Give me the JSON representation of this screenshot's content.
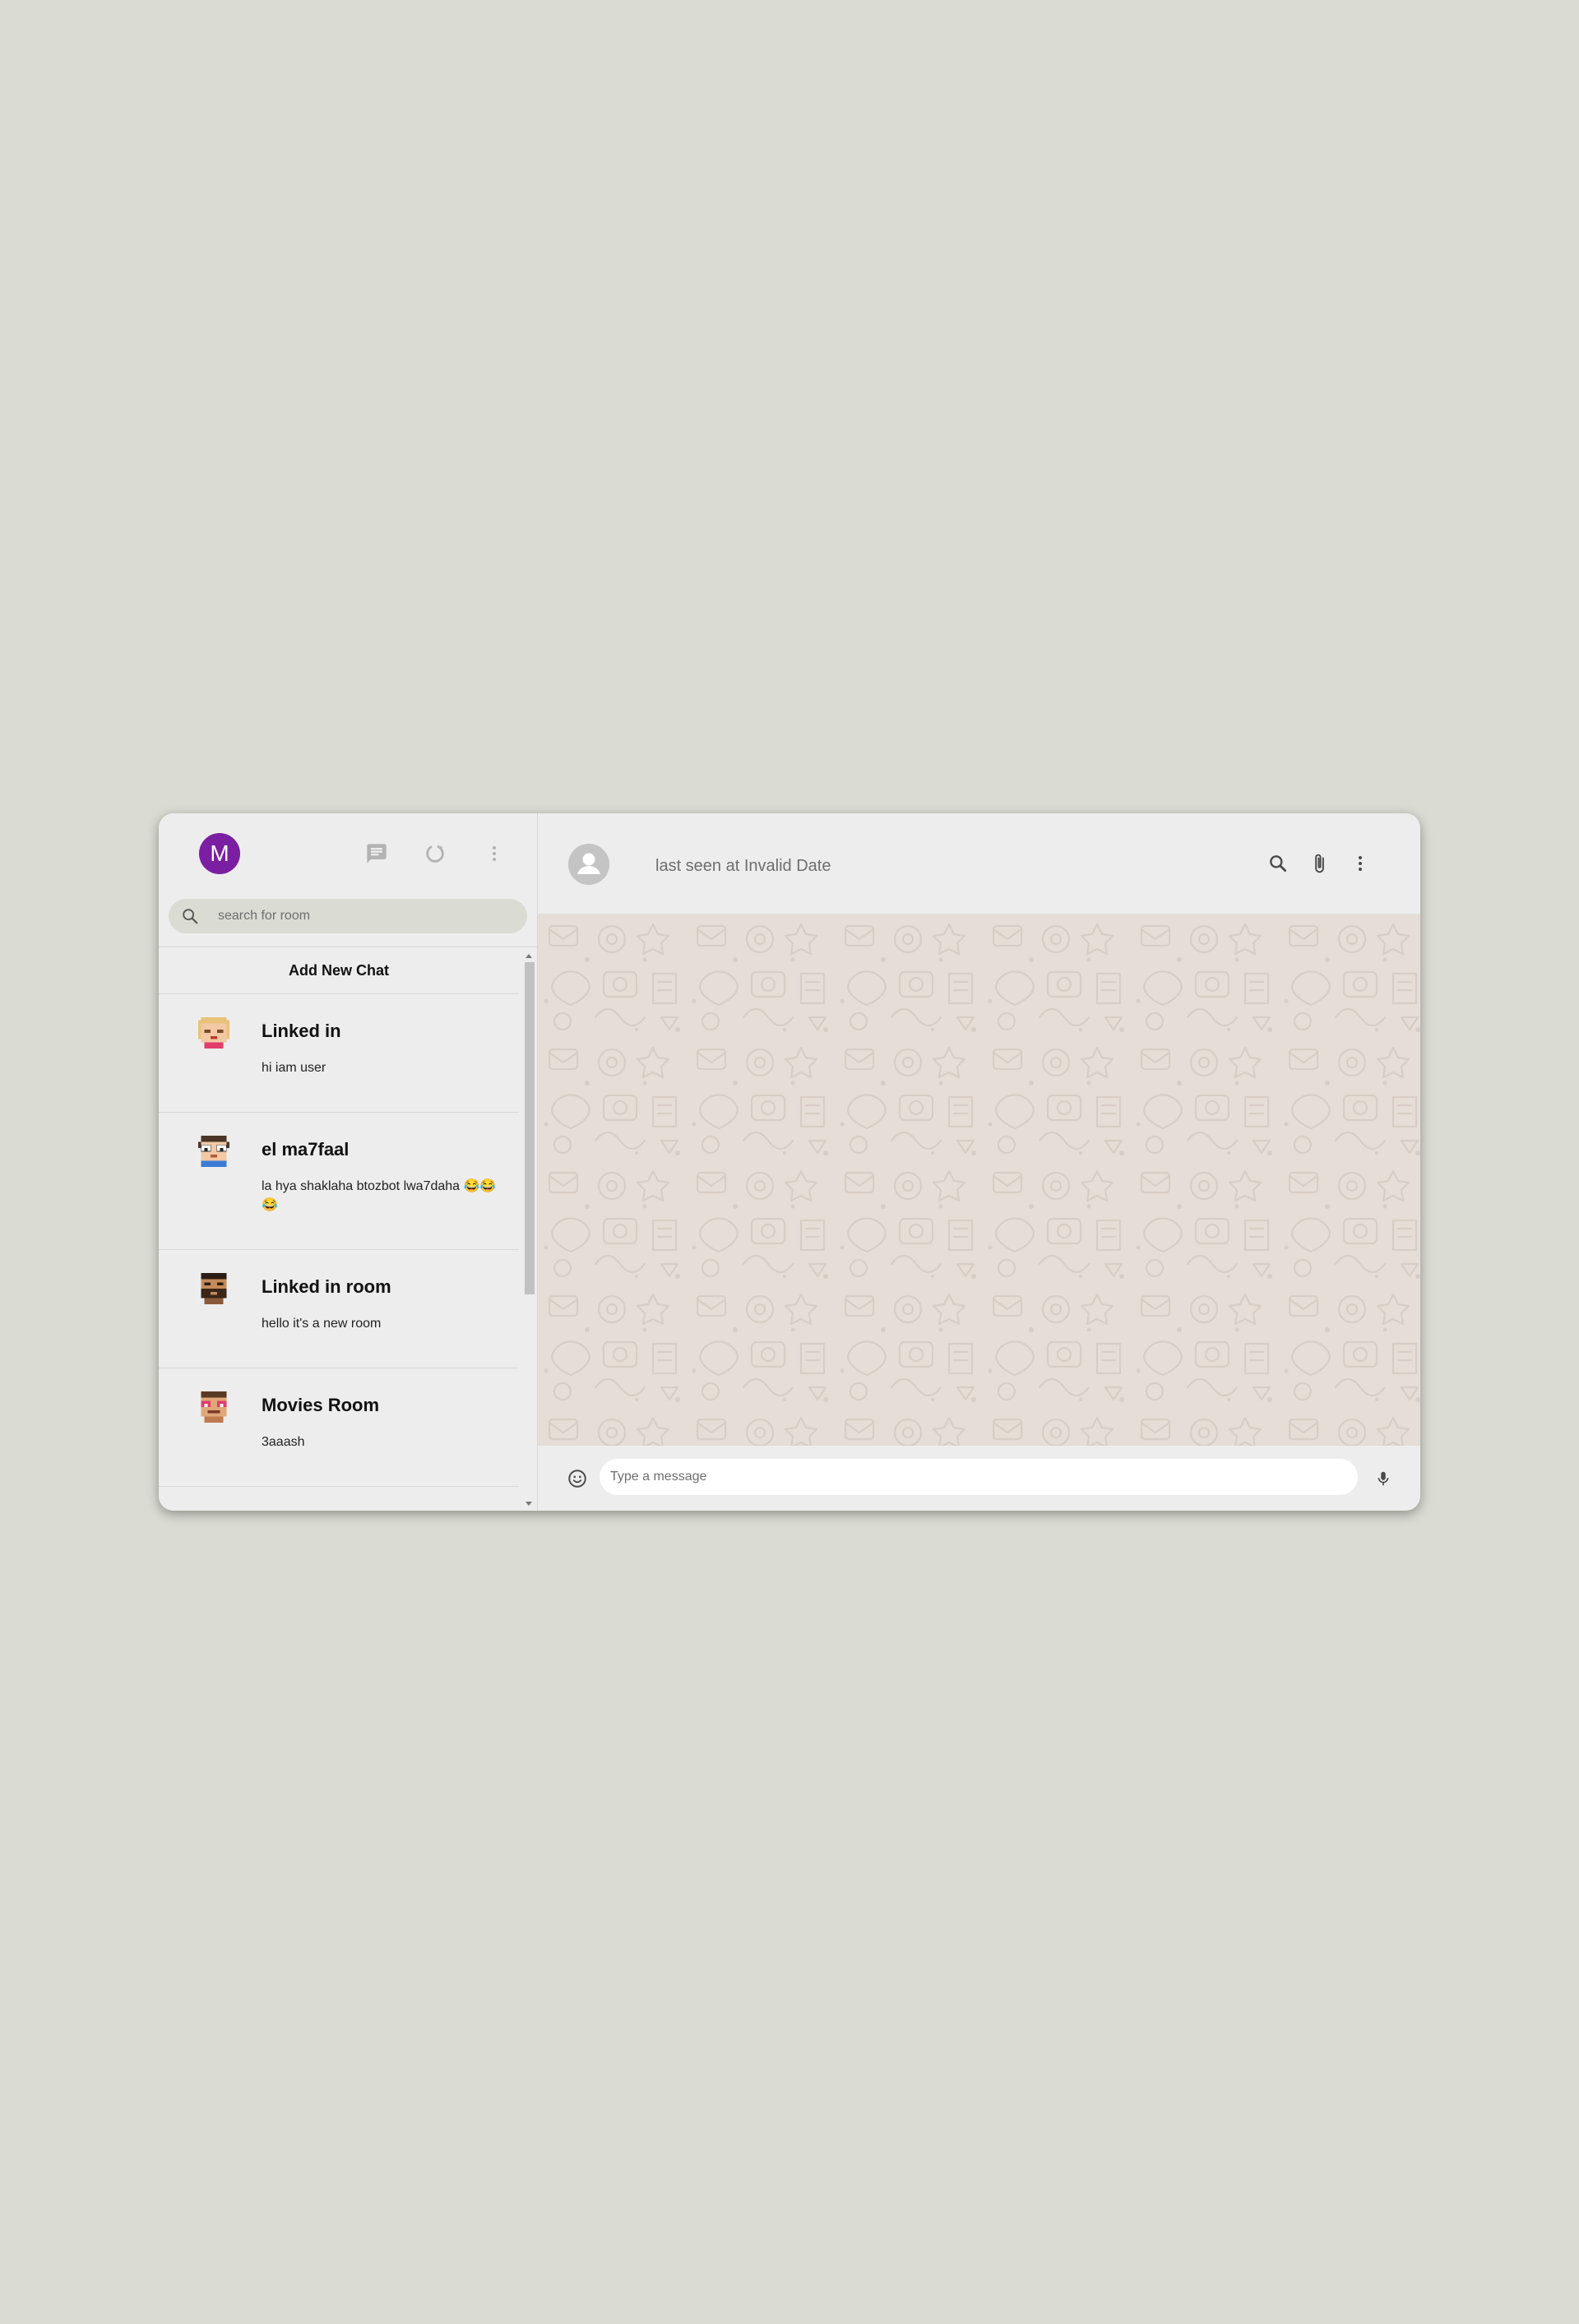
{
  "colors": {
    "page_background": "#dadbd3",
    "panel": "#ededed",
    "user_avatar": "#7b1fa2",
    "chat_background": "#e5ddd6",
    "icon_light": "#b3b3b3",
    "icon_dark": "#4a4a4a"
  },
  "sidebar": {
    "user_avatar_letter": "M",
    "header_icons": [
      "chat-icon",
      "status-icon",
      "more-vert-icon"
    ],
    "search": {
      "icon": "search-icon",
      "placeholder": "search for room"
    },
    "add_new_chat_label": "Add New Chat",
    "rooms": [
      {
        "name": "Linked in",
        "last_message": "hi iam user",
        "avatar": "pixel-avatar-blonde"
      },
      {
        "name": "el ma7faal",
        "last_message": "la hya shaklaha btozbot lwa7daha 😂😂😂",
        "avatar": "pixel-avatar-glasses"
      },
      {
        "name": "Linked in room",
        "last_message": "hello it's a new room",
        "avatar": "pixel-avatar-beard"
      },
      {
        "name": "Movies Room",
        "last_message": "3aaash",
        "avatar": "pixel-avatar-redglasses"
      }
    ]
  },
  "chat": {
    "header": {
      "avatar": "default-user-icon",
      "status": "last seen at Invalid Date",
      "icons": [
        "search-icon",
        "attach-icon",
        "more-vert-icon"
      ]
    },
    "footer": {
      "emoji_icon": "emoji-icon",
      "placeholder": "Type a message",
      "mic_icon": "mic-icon"
    }
  }
}
